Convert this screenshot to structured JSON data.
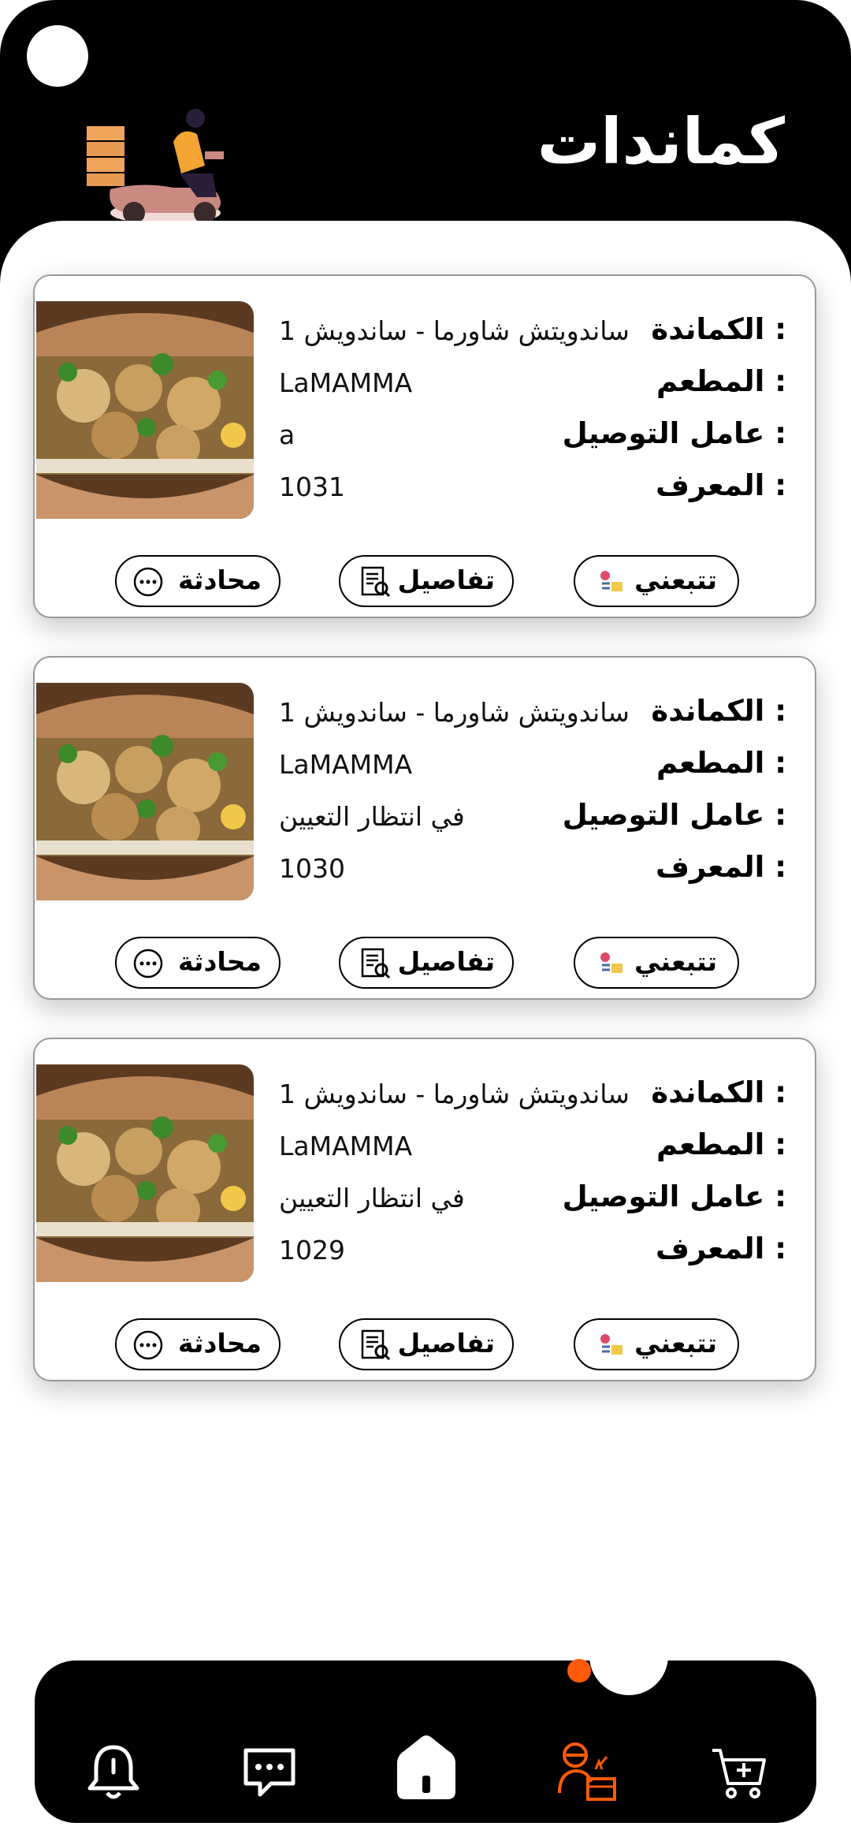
{
  "header": {
    "title": "كماندات"
  },
  "labels": {
    "order": ": الكماندة",
    "restaurant": ": المطعم",
    "courier": ": عامل التوصيل",
    "id": ": المعرف"
  },
  "buttons": {
    "track": "تتبعني",
    "details": "تفاصيل",
    "chat": "محادثة"
  },
  "orders": [
    {
      "order": "ساندويتش شاورما - ساندويش 1",
      "restaurant": "LaMAMMA",
      "courier": "a",
      "id": "1031"
    },
    {
      "order": "ساندويتش شاورما - ساندويش 1",
      "restaurant": "LaMAMMA",
      "courier": "في انتظار التعيين",
      "id": "1030"
    },
    {
      "order": "ساندويتش شاورما - ساندويش 1",
      "restaurant": "LaMAMMA",
      "courier": "في انتظار التعيين",
      "id": "1029"
    }
  ],
  "nav": {
    "items": [
      "bell-icon",
      "chat-icon",
      "home-icon",
      "delivery-icon",
      "cart-add-icon"
    ],
    "active": "delivery-icon",
    "accent": "#ff5a0a"
  }
}
